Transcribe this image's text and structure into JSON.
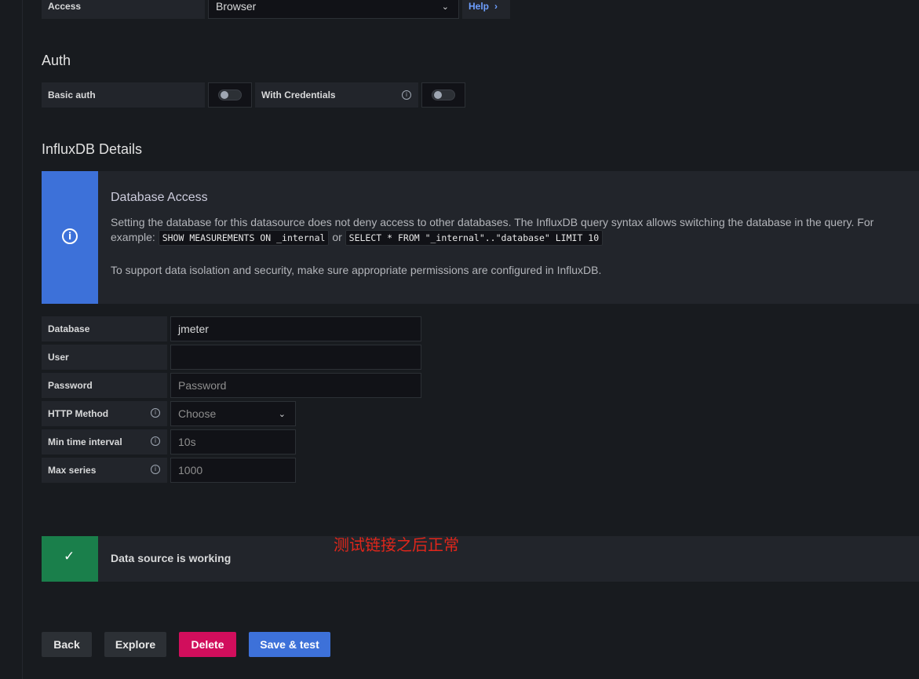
{
  "access_row": {
    "label": "Access",
    "value": "Browser",
    "help_label": "Help"
  },
  "auth": {
    "title": "Auth",
    "basic_auth_label": "Basic auth",
    "with_credentials_label": "With Credentials"
  },
  "influx": {
    "title": "InfluxDB Details",
    "alert": {
      "title": "Database Access",
      "text_1": "Setting the database for this datasource does not deny access to other databases. The InfluxDB query syntax allows switching the database in the query. For",
      "text_2_prefix": "example:",
      "code_1": "SHOW MEASUREMENTS ON _internal",
      "or_word": "or",
      "code_2": "SELECT * FROM \"_internal\"..\"database\" LIMIT 10",
      "text_3": "To support data isolation and security, make sure appropriate permissions are configured in InfluxDB."
    },
    "fields": {
      "database": {
        "label": "Database",
        "value": "jmeter"
      },
      "user": {
        "label": "User",
        "value": ""
      },
      "password": {
        "label": "Password",
        "placeholder": "Password"
      },
      "http_method": {
        "label": "HTTP Method",
        "placeholder": "Choose"
      },
      "min_time_interval": {
        "label": "Min time interval",
        "placeholder": "10s"
      },
      "max_series": {
        "label": "Max series",
        "placeholder": "1000"
      }
    }
  },
  "status": {
    "message": "Data source is working",
    "annotation": "测试链接之后正常"
  },
  "buttons": {
    "back": "Back",
    "explore": "Explore",
    "delete": "Delete",
    "save_test": "Save & test"
  },
  "colors": {
    "blue": "#3d71d9",
    "green": "#1a7f4b",
    "red": "#d10e5c",
    "annotation": "#e0261b"
  }
}
